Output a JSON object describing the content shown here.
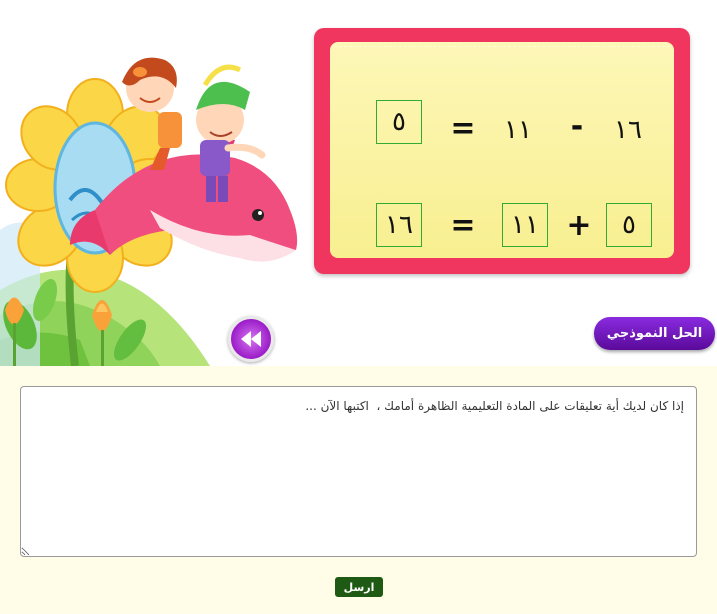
{
  "equations": {
    "subtraction": {
      "minuend": "١٦",
      "operator": "-",
      "subtrahend": "١١",
      "equals": "=",
      "result": "٥"
    },
    "addition": {
      "addend1": "٥",
      "operator": "+",
      "addend2": "١١",
      "equals": "=",
      "sum": "١٦"
    }
  },
  "buttons": {
    "model_solution": "الحل النموذجي",
    "send": "ارسل",
    "rewind_icon": "rewind-icon"
  },
  "comment": {
    "placeholder": "إذا كان لديك أية تعليقات على المادة التعليمية الظاهرة أمامك ،  اكتبها الآن ..."
  },
  "colors": {
    "card_border": "#f0365e",
    "card_fill": "#fbf4a6",
    "box_border": "#33aa33",
    "model_button": "#6a14b0",
    "send_button": "#1f5a14",
    "rewind_button": "#a62ad0"
  }
}
